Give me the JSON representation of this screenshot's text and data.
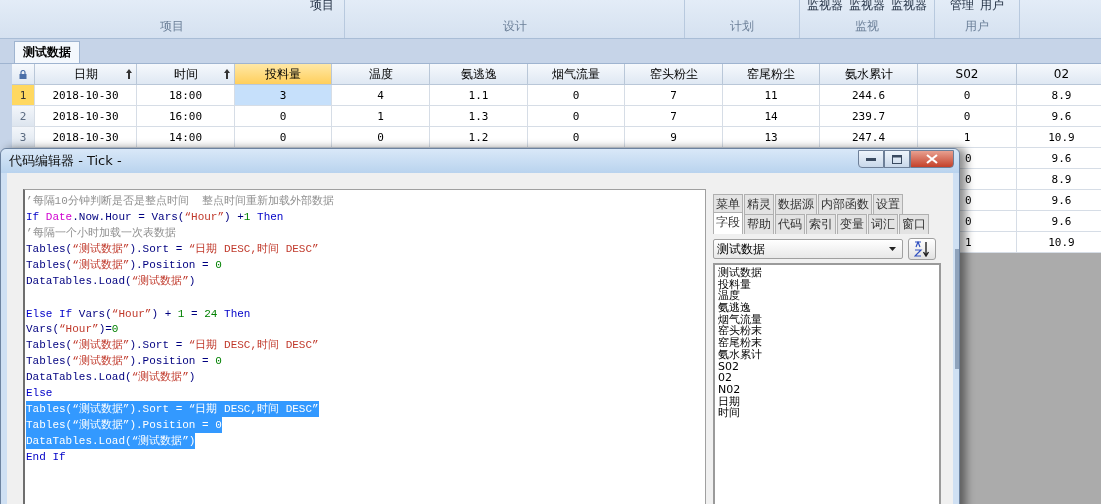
{
  "ribbon": {
    "groups": [
      {
        "name": "项目",
        "buttons": [
          "项目"
        ]
      },
      {
        "name": "设计"
      },
      {
        "name": "计划"
      },
      {
        "name": "监视",
        "buttons": [
          "监视器",
          "监视器",
          "监视器"
        ]
      },
      {
        "name": "用户",
        "buttons": [
          "管理",
          "用户"
        ]
      }
    ]
  },
  "doc_tab": {
    "label": "测试数据",
    "selected": true
  },
  "table": {
    "columns": [
      {
        "label": "日期",
        "sorted": true,
        "selected": false
      },
      {
        "label": "时间",
        "sorted": true,
        "selected": false
      },
      {
        "label": "投料量",
        "sorted": false,
        "selected": true
      },
      {
        "label": "温度",
        "sorted": false,
        "selected": false
      },
      {
        "label": "氨逃逸",
        "sorted": false,
        "selected": false
      },
      {
        "label": "烟气流量",
        "sorted": false,
        "selected": false
      },
      {
        "label": "窑头粉尘",
        "sorted": false,
        "selected": false
      },
      {
        "label": "窑尾粉尘",
        "sorted": false,
        "selected": false
      },
      {
        "label": "氨水累计",
        "sorted": false,
        "selected": false
      },
      {
        "label": "S02",
        "sorted": false,
        "selected": false
      },
      {
        "label": "02",
        "sorted": false,
        "selected": false
      }
    ],
    "rows": [
      {
        "number": "1",
        "selected": true,
        "cells": [
          "2018-10-30",
          "18:00",
          "3",
          "4",
          "1.1",
          "0",
          "7",
          "11",
          "244.6",
          "0",
          "8.9"
        ]
      },
      {
        "number": "2",
        "selected": false,
        "cells": [
          "2018-10-30",
          "16:00",
          "0",
          "1",
          "1.3",
          "0",
          "7",
          "14",
          "239.7",
          "0",
          "9.6"
        ]
      },
      {
        "number": "3",
        "selected": false,
        "cells": [
          "2018-10-30",
          "14:00",
          "0",
          "0",
          "1.2",
          "0",
          "9",
          "13",
          "247.4",
          "1",
          "10.9"
        ]
      }
    ],
    "rows_behind_editor": [
      {
        "s02": "0",
        "o2": "9.6"
      },
      {
        "s02": "0",
        "o2": "8.9"
      },
      {
        "s02": "0",
        "o2": "9.6"
      },
      {
        "s02": "0",
        "o2": "9.6"
      },
      {
        "s02": "1",
        "o2": "10.9"
      }
    ]
  },
  "editor": {
    "title": "代码编辑器 - Tick -",
    "lines": [
      {
        "selected": false,
        "tokens": [
          {
            "kind": "cmt",
            "text": "’每隔10分钟判断是否是整点时间  整点时间重新加载外部数据"
          }
        ]
      },
      {
        "selected": false,
        "tokens": [
          {
            "kind": "kw",
            "text": "If "
          },
          {
            "kind": "sys",
            "text": "Date"
          },
          {
            "kind": "id",
            "text": ".Now.Hour = Vars("
          },
          {
            "kind": "str",
            "text": "“Hour”"
          },
          {
            "kind": "id",
            "text": ") +"
          },
          {
            "kind": "num",
            "text": "1"
          },
          {
            "kind": "kw",
            "text": " Then"
          }
        ]
      },
      {
        "selected": false,
        "tokens": [
          {
            "kind": "cmt",
            "text": "’每隔一个小时加载一次表数据"
          }
        ]
      },
      {
        "selected": false,
        "tokens": [
          {
            "kind": "id",
            "text": "Tables("
          },
          {
            "kind": "str",
            "text": "“测试数据”"
          },
          {
            "kind": "id",
            "text": ").Sort = "
          },
          {
            "kind": "str",
            "text": "“日期 DESC,时间 DESC”"
          }
        ]
      },
      {
        "selected": false,
        "tokens": [
          {
            "kind": "id",
            "text": "Tables("
          },
          {
            "kind": "str",
            "text": "“测试数据”"
          },
          {
            "kind": "id",
            "text": ").Position = "
          },
          {
            "kind": "num",
            "text": "0"
          }
        ]
      },
      {
        "selected": false,
        "tokens": [
          {
            "kind": "id",
            "text": "DataTables.Load("
          },
          {
            "kind": "str",
            "text": "“测试数据”"
          },
          {
            "kind": "id",
            "text": ")"
          }
        ]
      },
      {
        "selected": false,
        "blank_before": true,
        "tokens": [
          {
            "kind": "kw",
            "text": "Else If "
          },
          {
            "kind": "id",
            "text": "Vars("
          },
          {
            "kind": "str",
            "text": "“Hour”"
          },
          {
            "kind": "id",
            "text": ") + "
          },
          {
            "kind": "num",
            "text": "1"
          },
          {
            "kind": "id",
            "text": " = "
          },
          {
            "kind": "num",
            "text": "24"
          },
          {
            "kind": "kw",
            "text": " Then"
          }
        ]
      },
      {
        "selected": false,
        "tokens": [
          {
            "kind": "id",
            "text": "Vars("
          },
          {
            "kind": "str",
            "text": "“Hour”"
          },
          {
            "kind": "id",
            "text": ")="
          },
          {
            "kind": "num",
            "text": "0"
          }
        ]
      },
      {
        "selected": false,
        "tokens": [
          {
            "kind": "id",
            "text": "Tables("
          },
          {
            "kind": "str",
            "text": "“测试数据”"
          },
          {
            "kind": "id",
            "text": ").Sort = "
          },
          {
            "kind": "str",
            "text": "“日期 DESC,时间 DESC”"
          }
        ]
      },
      {
        "selected": false,
        "tokens": [
          {
            "kind": "id",
            "text": "Tables("
          },
          {
            "kind": "str",
            "text": "“测试数据”"
          },
          {
            "kind": "id",
            "text": ").Position = "
          },
          {
            "kind": "num",
            "text": "0"
          }
        ]
      },
      {
        "selected": false,
        "tokens": [
          {
            "kind": "id",
            "text": "DataTables.Load("
          },
          {
            "kind": "str",
            "text": "“测试数据”"
          },
          {
            "kind": "id",
            "text": ")"
          }
        ]
      },
      {
        "selected": false,
        "tokens": [
          {
            "kind": "kw",
            "text": "Else"
          }
        ]
      },
      {
        "selected": true,
        "tokens": [
          {
            "kind": "id",
            "text": "Tables("
          },
          {
            "kind": "str",
            "text": "“测试数据”"
          },
          {
            "kind": "id",
            "text": ").Sort = "
          },
          {
            "kind": "str",
            "text": "“日期 DESC,时间 DESC”"
          }
        ]
      },
      {
        "selected": true,
        "tokens": [
          {
            "kind": "id",
            "text": "Tables("
          },
          {
            "kind": "str",
            "text": "“测试数据”"
          },
          {
            "kind": "id",
            "text": ").Position = "
          },
          {
            "kind": "num",
            "text": "0"
          }
        ]
      },
      {
        "selected": true,
        "tokens": [
          {
            "kind": "id",
            "text": "DataTables.Load("
          },
          {
            "kind": "str",
            "text": "“测试数据”"
          },
          {
            "kind": "id",
            "text": ")"
          }
        ]
      },
      {
        "selected": false,
        "tokens": [
          {
            "kind": "kw",
            "text": "End If"
          }
        ]
      }
    ],
    "tab_rows": [
      [
        {
          "label": "菜单",
          "selected": false
        },
        {
          "label": "精灵",
          "selected": false
        },
        {
          "label": "数据源",
          "selected": false
        },
        {
          "label": "内部函数",
          "selected": false
        },
        {
          "label": "设置",
          "selected": false
        }
      ],
      [
        {
          "label": "字段",
          "selected": true
        },
        {
          "label": "帮助",
          "selected": false
        },
        {
          "label": "代码",
          "selected": false
        },
        {
          "label": "索引",
          "selected": false
        },
        {
          "label": "变量",
          "selected": false
        },
        {
          "label": "词汇",
          "selected": false
        },
        {
          "label": "窗口",
          "selected": false
        }
      ]
    ],
    "table_select": {
      "value": "测试数据"
    },
    "fields": [
      "测试数据",
      "投料量",
      "温度",
      "氨逃逸",
      "烟气流量",
      "窑头粉末",
      "窑尾粉末",
      "氨水累计",
      "S02",
      "02",
      "N02",
      "日期",
      "时间"
    ]
  }
}
